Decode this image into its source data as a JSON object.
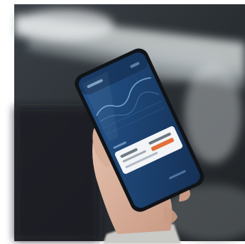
{
  "photo": {
    "subject": "hand-holding-smartphone",
    "palette": {
      "background_dark": "#2a2f33",
      "car_roof_light": "#cfd3d4",
      "screen_blue": "#1f4a7a",
      "screen_deep": "#16345a",
      "card_white": "#f2f4f6",
      "accent_orange": "#e2703a",
      "skin": "#d9b39f",
      "sleeve": "#c9c9c6"
    },
    "screen": {
      "card_accent_icon": "card-icon"
    }
  }
}
